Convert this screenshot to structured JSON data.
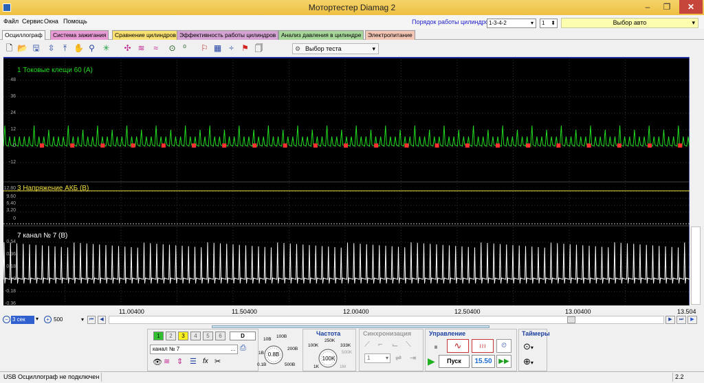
{
  "window": {
    "title": "Мотортестер Diamag 2",
    "min": "–",
    "max": "❐",
    "close": "✕"
  },
  "menu": [
    "Файл",
    "Сервис",
    "Окна",
    "Помощь"
  ],
  "cylinder_order": {
    "label": "Порядок работы цилиндров",
    "value": "1-3-4-2",
    "cyl": "1"
  },
  "auto_select": "Выбор авто",
  "tabs": [
    {
      "label": "Осциллограф",
      "color": "#f0f0f0",
      "active": true
    },
    {
      "label": "Система зажигания",
      "color": "#e79ad4"
    },
    {
      "label": "Сравнение цилиндров",
      "color": "#f8e070"
    },
    {
      "label": "Эффективность работы цилиндров",
      "color": "#d5a3d3"
    },
    {
      "label": "Анализ давления в цилиндре",
      "color": "#a6d69a"
    },
    {
      "label": "Электропитание",
      "color": "#f3c5b4"
    }
  ],
  "toolbar": {
    "test_select": "Выбор теста"
  },
  "channels": [
    {
      "name": "1 Токовые клещи 60 (А)",
      "color": "#22dd22",
      "yticks": [
        "48",
        "36",
        "24",
        "12",
        "0",
        "-12"
      ]
    },
    {
      "name": "3 Напряжение АКБ (В)",
      "color": "#f0e040",
      "yticks": [
        "12.80",
        "9.60",
        "6.40",
        "3.20",
        "0"
      ],
      "value": 12.4
    },
    {
      "name": "7 канал № 7 (В)",
      "color": "#ffffff",
      "yticks": [
        "0.54",
        "0.36",
        "0.18",
        "0",
        "-0.18",
        "-0.36"
      ]
    }
  ],
  "xaxis": {
    "ticks": [
      "11.00400",
      "11.50400",
      "12.00400",
      "12.50400",
      "13.00400",
      "13.504"
    ]
  },
  "time_controls": {
    "time": "3 сек",
    "points": "500"
  },
  "channel_buttons": [
    "1",
    "2",
    "3",
    "4",
    "5",
    "6",
    "D"
  ],
  "channel_select": "канал № 7",
  "knob_volt": {
    "center": "0.8В",
    "labels": [
      "10В",
      "100В",
      "200В",
      "500В",
      "1В",
      "0.1В"
    ]
  },
  "frequency": {
    "title": "Частота",
    "center": "100K",
    "labels": [
      "250K",
      "333K",
      "500K",
      "100K",
      "1K",
      "1M"
    ]
  },
  "sync": {
    "title": "Синхронизация",
    "value": "1"
  },
  "control": {
    "title": "Управление",
    "start": "Пуск",
    "value": "15.50"
  },
  "timers": {
    "title": "Таймеры"
  },
  "status": {
    "text": "USB Осциллограф не подключен",
    "version": "2.2"
  }
}
